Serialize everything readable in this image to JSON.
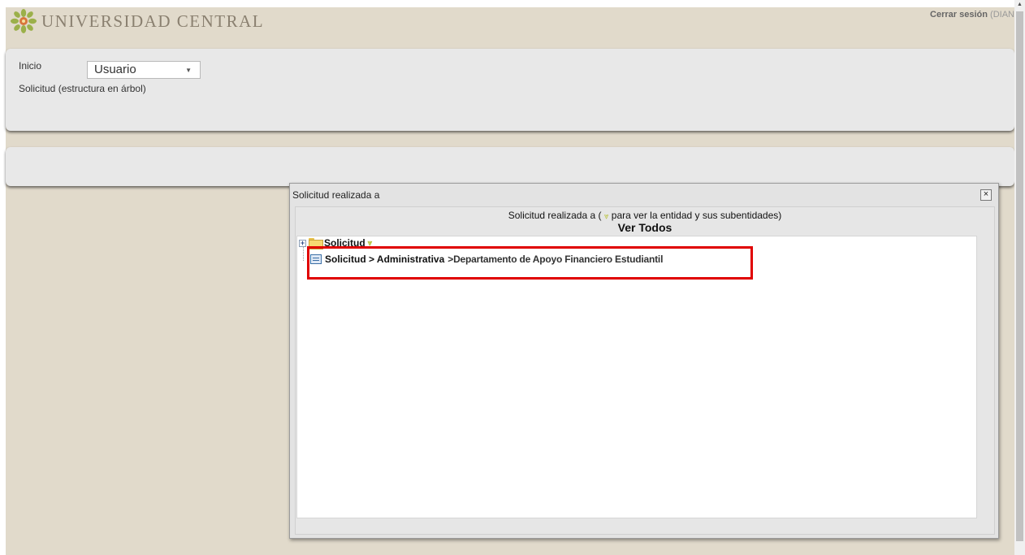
{
  "header": {
    "logo_text": "UNIVERSIDAD CENTRAL",
    "logout_label": "Cerrar sesión",
    "user_label": "(DIAN"
  },
  "nav": {
    "home_label": "Inicio",
    "user_select_value": "Usuario",
    "breadcrumb": "Solicitud (estructura en árbol)"
  },
  "dialog": {
    "title": "Solicitud realizada a",
    "close_label": "×",
    "subtitle_before": "Solicitud realizada a (",
    "subtitle_after": "para ver la entidad y sus subentidades)",
    "see_all": "Ver Todos",
    "tree": {
      "root_label": "Solicitud",
      "child_path": "Solicitud > Administrativa",
      "child_entity": " >Departamento de Apoyo Financiero Estudiantil"
    }
  },
  "colors": {
    "canvas": "#e1dacb",
    "panel": "#e8e8e8",
    "highlight": "#e00000",
    "expand_arrow": "#b9c23a"
  },
  "icons": [
    "logo-flower-icon",
    "chevron-down-icon",
    "close-icon",
    "expand-plus-icon",
    "folder-icon",
    "entity-icon",
    "scroll-up-icon"
  ]
}
